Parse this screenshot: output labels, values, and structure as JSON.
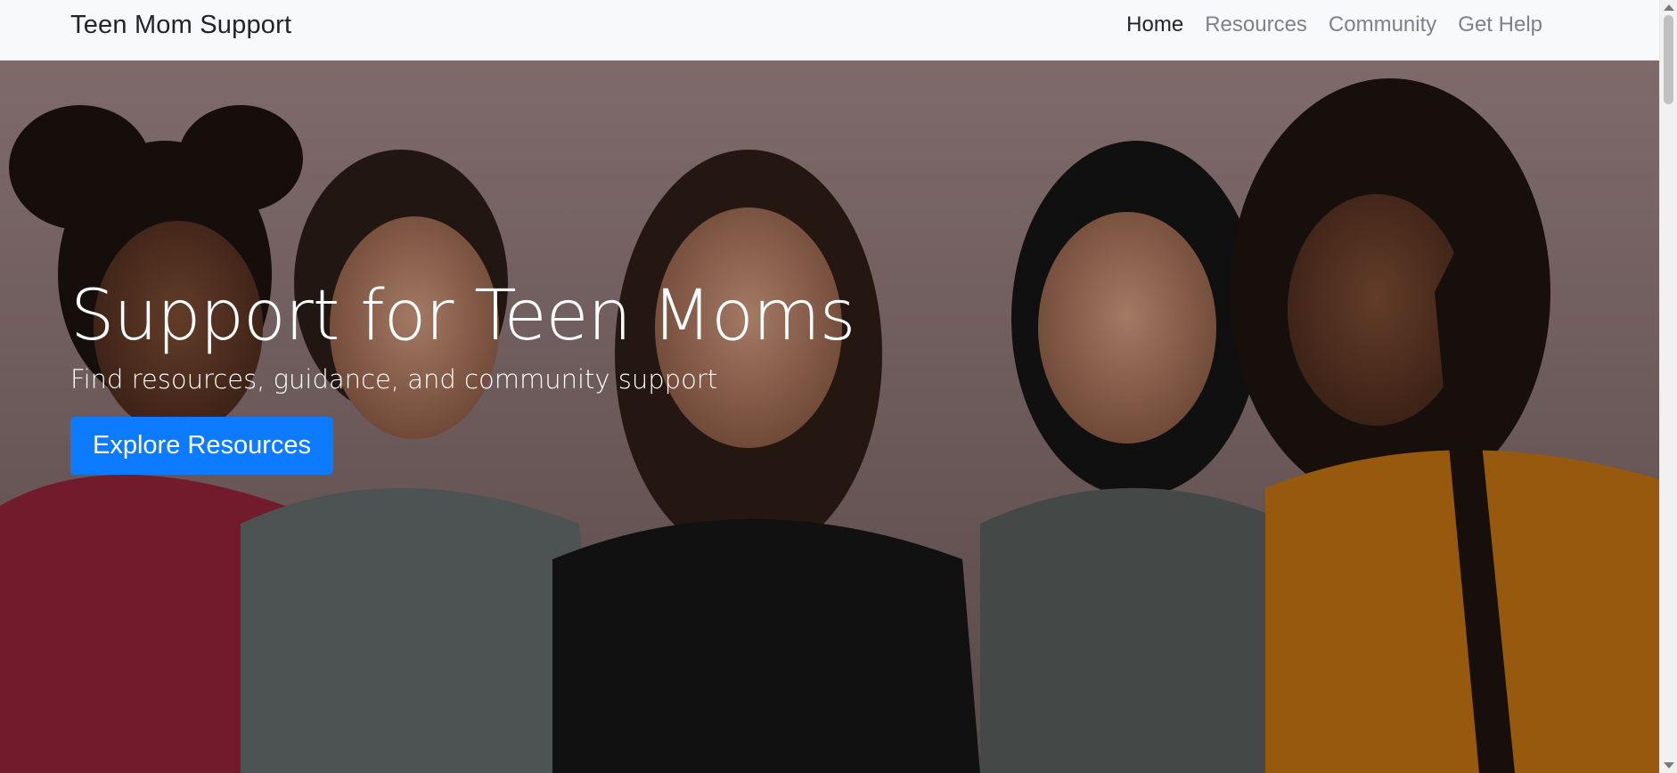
{
  "brand": "Teen Mom Support",
  "nav": {
    "items": [
      {
        "label": "Home",
        "active": true
      },
      {
        "label": "Resources",
        "active": false
      },
      {
        "label": "Community",
        "active": false
      },
      {
        "label": "Get Help",
        "active": false
      }
    ]
  },
  "hero": {
    "title": "Support for Teen Moms",
    "subtitle": "Find resources, guidance, and community support",
    "button_label": "Explore Resources",
    "image_icon": "group-photo-of-young-women"
  },
  "colors": {
    "navbar_bg": "#f8f9fa",
    "accent": "#0d7bff",
    "nav_active": "#212529",
    "nav_inactive": "#7c8288"
  }
}
